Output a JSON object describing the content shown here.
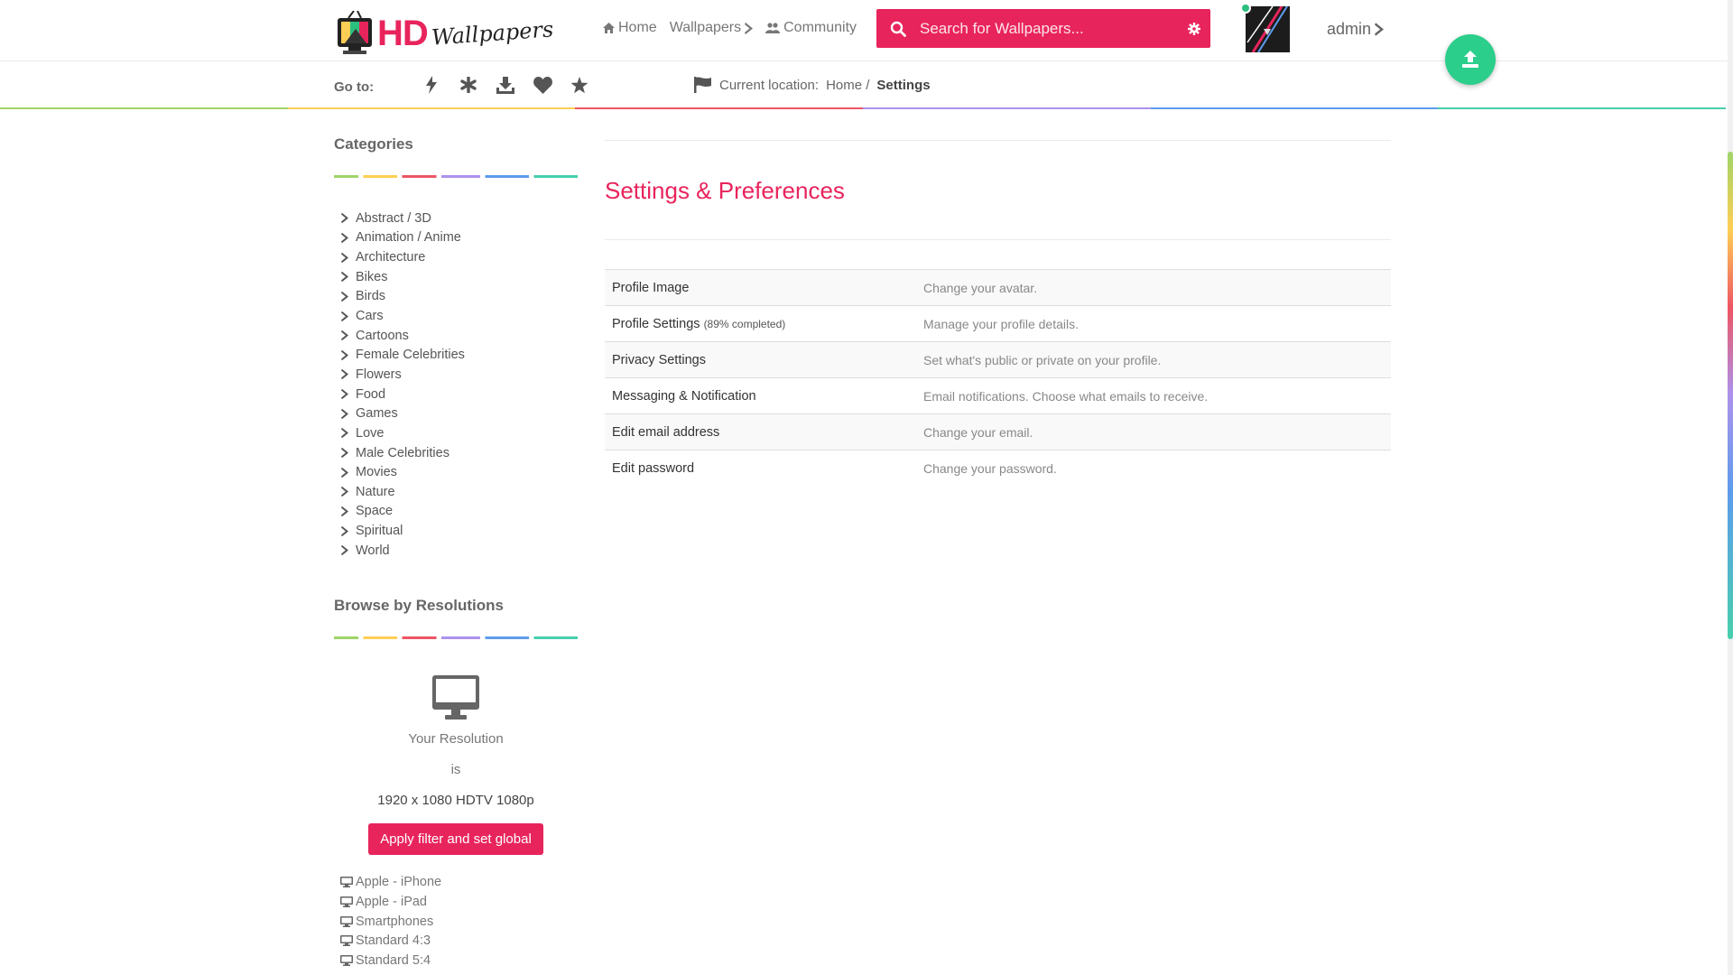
{
  "header": {
    "logo_hd": "HD",
    "logo_script": "Wallpapers",
    "nav": [
      {
        "label": "Home",
        "icon": "home-icon"
      },
      {
        "label": "Wallpapers",
        "icon": "chevron-right-icon"
      },
      {
        "label": "Community",
        "icon": "users-icon"
      }
    ],
    "search_placeholder": "Search for Wallpapers...",
    "user_label": "admin"
  },
  "subbar": {
    "goto_label": "Go to:",
    "goto_icons": [
      "bolt-icon",
      "asterisk-icon",
      "download-icon",
      "heart-icon",
      "star-icon"
    ],
    "location_label": "Current location:",
    "breadcrumb_home": "Home /",
    "breadcrumb_current": "Settings"
  },
  "sidebar": {
    "categories_title": "Categories",
    "categories": [
      "Abstract / 3D",
      "Animation / Anime",
      "Architecture",
      "Bikes",
      "Birds",
      "Cars",
      "Cartoons",
      "Female Celebrities",
      "Flowers",
      "Food",
      "Games",
      "Love",
      "Male Celebrities",
      "Movies",
      "Nature",
      "Space",
      "Spiritual",
      "World"
    ],
    "resolutions_title": "Browse by Resolutions",
    "your_resolution": "Your Resolution",
    "is": "is",
    "resolution_value": "1920 x 1080 HDTV 1080p",
    "apply_button": "Apply filter and set global",
    "devices": [
      "Apple - iPhone",
      "Apple - iPad",
      "Smartphones",
      "Standard 4:3",
      "Standard 5:4"
    ]
  },
  "main": {
    "title": "Settings & Preferences",
    "settings": [
      {
        "name": "Profile Image",
        "note": "",
        "desc": "Change your avatar."
      },
      {
        "name": "Profile Settings",
        "note": "(89% completed)",
        "desc": "Manage your profile details."
      },
      {
        "name": "Privacy Settings",
        "note": "",
        "desc": "Set what's public or private on your profile."
      },
      {
        "name": "Messaging & Notification",
        "note": "",
        "desc": "Email notifications. Choose what emails to receive."
      },
      {
        "name": "Edit email address",
        "note": "",
        "desc": "Change your email."
      },
      {
        "name": "Edit password",
        "note": "",
        "desc": "Change your password."
      }
    ],
    "profile_completion_pct": 89
  },
  "colors": {
    "accent": "#e8245c",
    "fab": "#2bce8b",
    "rainbow": [
      "#a0d468",
      "#ffce54",
      "#ed5565",
      "#ac92ec",
      "#5d9cec",
      "#48cfad"
    ]
  }
}
